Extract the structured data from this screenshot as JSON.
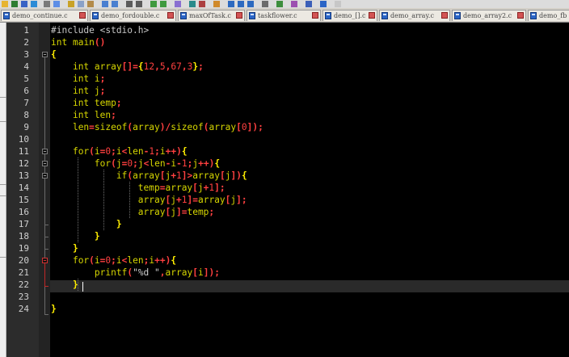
{
  "tabs": [
    {
      "label": "demo_continue.c"
    },
    {
      "label": "demo_fordouble.c"
    },
    {
      "label": "maxOfTask.c"
    },
    {
      "label": "taskflower.c"
    },
    {
      "label": "demo_[].c"
    },
    {
      "label": "demo_array.c"
    },
    {
      "label": "demo_array2.c"
    },
    {
      "label": "demo_fb"
    }
  ],
  "editor": {
    "current_line": 22,
    "lines": [
      {
        "n": "1",
        "t": "#include <stdio.h>"
      },
      {
        "n": "2",
        "t": "int main()"
      },
      {
        "n": "3",
        "t": "{"
      },
      {
        "n": "4",
        "t": "    int array[]={12,5,67,3};"
      },
      {
        "n": "5",
        "t": "    int i;"
      },
      {
        "n": "6",
        "t": "    int j;"
      },
      {
        "n": "7",
        "t": "    int temp;"
      },
      {
        "n": "8",
        "t": "    int len;"
      },
      {
        "n": "9",
        "t": "    len=sizeof(array)/sizeof(array[0]);"
      },
      {
        "n": "10",
        "t": ""
      },
      {
        "n": "11",
        "t": "    for(i=0;i<len-1;i++){"
      },
      {
        "n": "12",
        "t": "        for(j=0;j<len-i-1;j++){"
      },
      {
        "n": "13",
        "t": "            if(array[j+1]>array[j]){"
      },
      {
        "n": "14",
        "t": "                temp=array[j+1];"
      },
      {
        "n": "15",
        "t": "                array[j+1]=array[j];"
      },
      {
        "n": "16",
        "t": "                array[j]=temp;"
      },
      {
        "n": "17",
        "t": "            }"
      },
      {
        "n": "18",
        "t": "        }"
      },
      {
        "n": "19",
        "t": "    }"
      },
      {
        "n": "20",
        "t": "    for(i=0;i<len;i++){"
      },
      {
        "n": "21",
        "t": "        printf(\"%d \",array[i]);"
      },
      {
        "n": "22",
        "t": "    }"
      },
      {
        "n": "23",
        "t": ""
      },
      {
        "n": "24",
        "t": "}"
      }
    ]
  },
  "colors": {
    "editor_bg": "#000000",
    "keyword": "#d6d600",
    "operator": "#ff4040",
    "number": "#ff4040",
    "brace": "#ffee00",
    "text": "#cfcfcf"
  },
  "icons": {
    "file_tab_icon": "file-tab-icon",
    "close_tab_icon": "close-tab-icon",
    "fold_marker_icon": "fold-marker-icon"
  }
}
